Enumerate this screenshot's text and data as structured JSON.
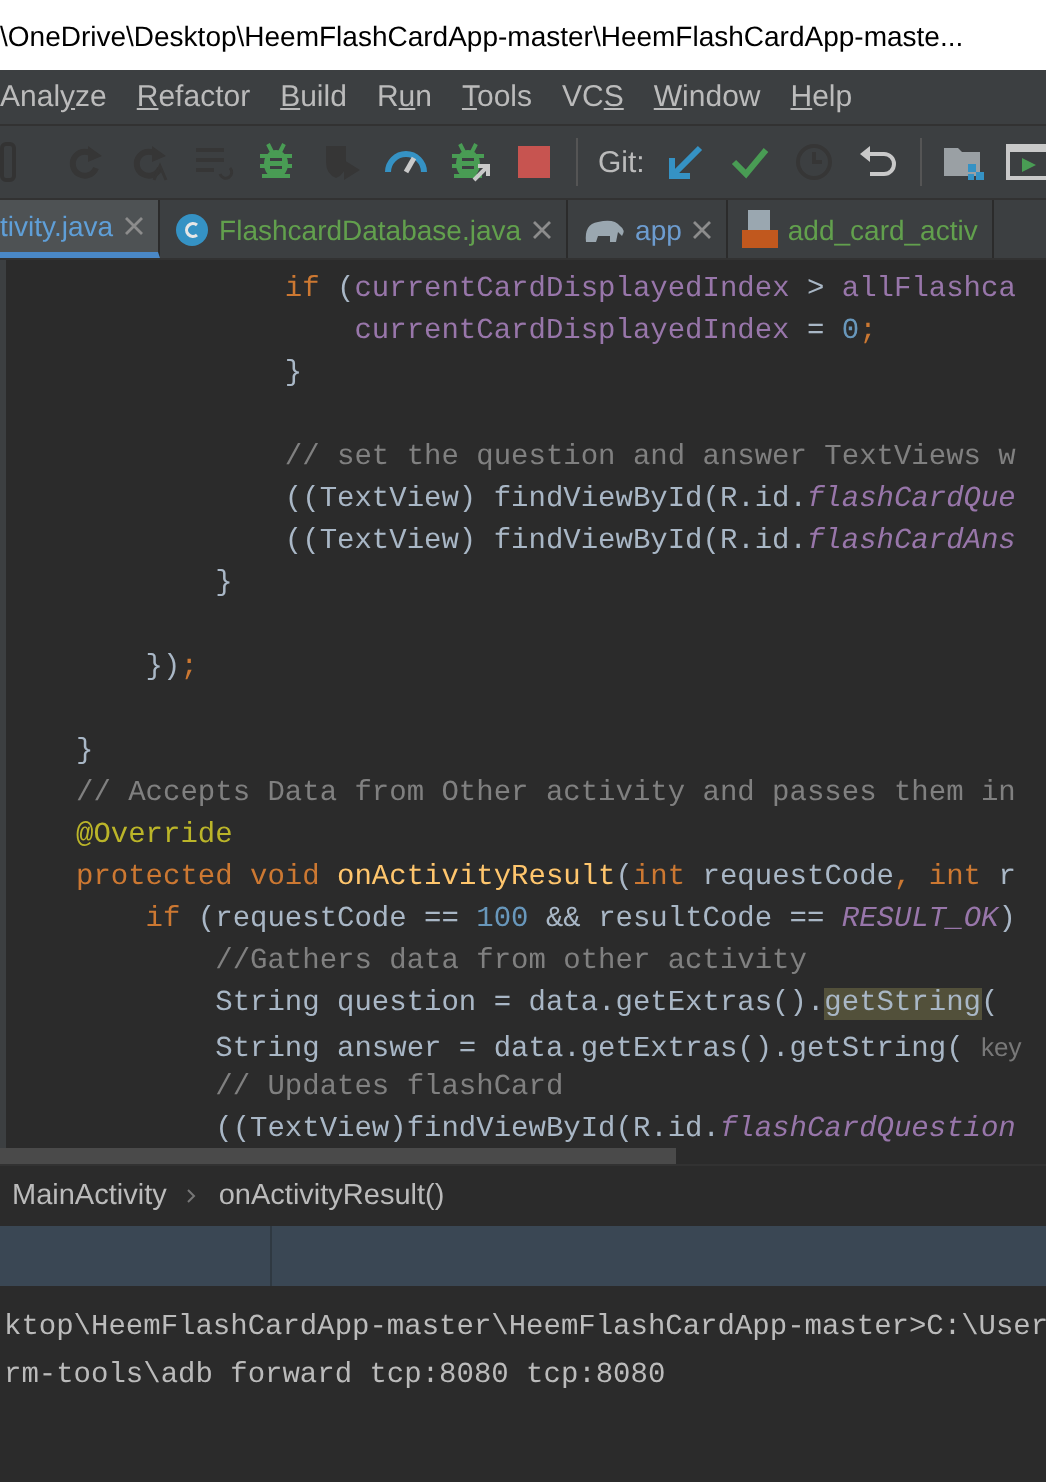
{
  "window": {
    "title": "\\OneDrive\\Desktop\\HeemFlashCardApp-master\\HeemFlashCardApp-maste..."
  },
  "menu": [
    {
      "before": "Anal",
      "key": "y",
      "after": "ze"
    },
    {
      "key": "R",
      "after": "efactor"
    },
    {
      "key": "B",
      "after": "uild"
    },
    {
      "before": "R",
      "key": "u",
      "after": "n"
    },
    {
      "key": "T",
      "after": "ools"
    },
    {
      "before": "VC",
      "key": "S"
    },
    {
      "key": "W",
      "after": "indow"
    },
    {
      "key": "H",
      "after": "elp"
    }
  ],
  "toolbar": [
    {
      "kind": "frame",
      "disabled": true
    },
    {
      "kind": "rerun",
      "disabled": true
    },
    {
      "kind": "rerun-a",
      "disabled": true
    },
    {
      "kind": "list",
      "disabled": true
    },
    {
      "kind": "bug",
      "disabled": false
    },
    {
      "kind": "shield",
      "disabled": true
    },
    {
      "kind": "gauge",
      "disabled": false
    },
    {
      "kind": "bug-attach",
      "disabled": false
    },
    {
      "kind": "stop",
      "disabled": false
    },
    {
      "kind": "sep"
    },
    {
      "kind": "label",
      "text": "Git:"
    },
    {
      "kind": "update",
      "disabled": false
    },
    {
      "kind": "commit",
      "disabled": false
    },
    {
      "kind": "history",
      "disabled": true
    },
    {
      "kind": "revert",
      "disabled": false
    },
    {
      "kind": "sep"
    },
    {
      "kind": "structure",
      "disabled": false
    },
    {
      "kind": "run-window",
      "disabled": false
    }
  ],
  "tabs": [
    {
      "label": "tivity.java",
      "kind": "none",
      "selected": true,
      "color": "#5f9fd8",
      "closable": true
    },
    {
      "label": "FlashcardDatabase.java",
      "kind": "class",
      "selected": false,
      "color": "#62a04d",
      "closable": true
    },
    {
      "label": "app",
      "kind": "gradle",
      "selected": false,
      "color": "#6d9ccf",
      "closable": true
    },
    {
      "label": "add_card_activ",
      "kind": "xml",
      "selected": false,
      "color": "#62a04d",
      "closable": false
    }
  ],
  "code": [
    {
      "kind": "code",
      "tokens": [
        {
          "t": "            if",
          "kind": "kw"
        },
        {
          "t": " ("
        },
        {
          "t": "currentCardDisplayedIndex",
          "kind": "field"
        },
        {
          "t": " > "
        },
        {
          "t": "allFlashca",
          "kind": "field"
        }
      ]
    },
    {
      "kind": "code",
      "tokens": [
        {
          "t": "                currentCardDisplayedIndex",
          "kind": "field"
        },
        {
          "t": " = "
        },
        {
          "t": "0",
          "kind": "num"
        },
        {
          "t": ";",
          "kind": "kw"
        }
      ]
    },
    {
      "kind": "code",
      "tokens": [
        {
          "t": "            }"
        }
      ]
    },
    {
      "kind": "blank"
    },
    {
      "kind": "code",
      "tokens": [
        {
          "t": "            // set the question and answer TextViews w",
          "kind": "comment"
        }
      ]
    },
    {
      "kind": "code",
      "tokens": [
        {
          "t": "            ((TextView) findViewById(R.id."
        },
        {
          "t": "flashCardQue",
          "kind": "ifield"
        }
      ]
    },
    {
      "kind": "code",
      "tokens": [
        {
          "t": "            ((TextView) findViewById(R.id."
        },
        {
          "t": "flashCardAns",
          "kind": "ifield"
        }
      ]
    },
    {
      "kind": "code",
      "tokens": [
        {
          "t": "        }"
        }
      ]
    },
    {
      "kind": "blank"
    },
    {
      "kind": "code",
      "tokens": [
        {
          "t": "    })"
        },
        {
          "t": ";",
          "kind": "kw"
        }
      ]
    },
    {
      "kind": "blank"
    },
    {
      "kind": "code",
      "tokens": [
        {
          "t": "}"
        }
      ]
    },
    {
      "kind": "code",
      "tokens": [
        {
          "t": "// Accepts Data from Other activity and passes them in",
          "kind": "comment"
        }
      ]
    },
    {
      "kind": "code",
      "tokens": [
        {
          "t": "@Override",
          "kind": "ann"
        }
      ]
    },
    {
      "kind": "code",
      "tokens": [
        {
          "t": "protected void ",
          "kind": "kw"
        },
        {
          "t": "onActivityResult",
          "kind": "method"
        },
        {
          "t": "("
        },
        {
          "t": "int ",
          "kind": "kw"
        },
        {
          "t": "requestCode"
        },
        {
          "t": ", ",
          "kind": "kw"
        },
        {
          "t": "int ",
          "kind": "kw"
        },
        {
          "t": "r"
        }
      ]
    },
    {
      "kind": "code",
      "tokens": [
        {
          "t": "    if ",
          "kind": "kw"
        },
        {
          "t": "(requestCode == "
        },
        {
          "t": "100",
          "kind": "num"
        },
        {
          "t": " && resultCode == "
        },
        {
          "t": "RESULT_OK",
          "kind": "ifield"
        },
        {
          "t": ")"
        }
      ]
    },
    {
      "kind": "code",
      "tokens": [
        {
          "t": "        //Gathers data from other activity",
          "kind": "comment"
        }
      ]
    },
    {
      "kind": "code",
      "tokens": [
        {
          "t": "        String question = data.getExtras()."
        },
        {
          "t": "getString",
          "kind": "match"
        },
        {
          "t": "("
        }
      ]
    },
    {
      "kind": "code",
      "tokens": [
        {
          "t": "        String answer = data.getExtras().getString( "
        },
        {
          "t": "key",
          "kind": "hint"
        }
      ]
    },
    {
      "kind": "code",
      "tokens": [
        {
          "t": "        // Updates flashCard",
          "kind": "comment"
        }
      ]
    },
    {
      "kind": "code",
      "tokens": [
        {
          "t": "        ((TextView)findViewById(R.id."
        },
        {
          "t": "flashCardQuestion",
          "kind": "ifield"
        }
      ]
    }
  ],
  "breadcrumb": [
    "MainActivity",
    "onActivityResult()"
  ],
  "terminal": [
    "ktop\\HeemFlashCardApp-master\\HeemFlashCardApp-master>C:\\User",
    "rm-tools\\adb forward tcp:8080 tcp:8080"
  ]
}
